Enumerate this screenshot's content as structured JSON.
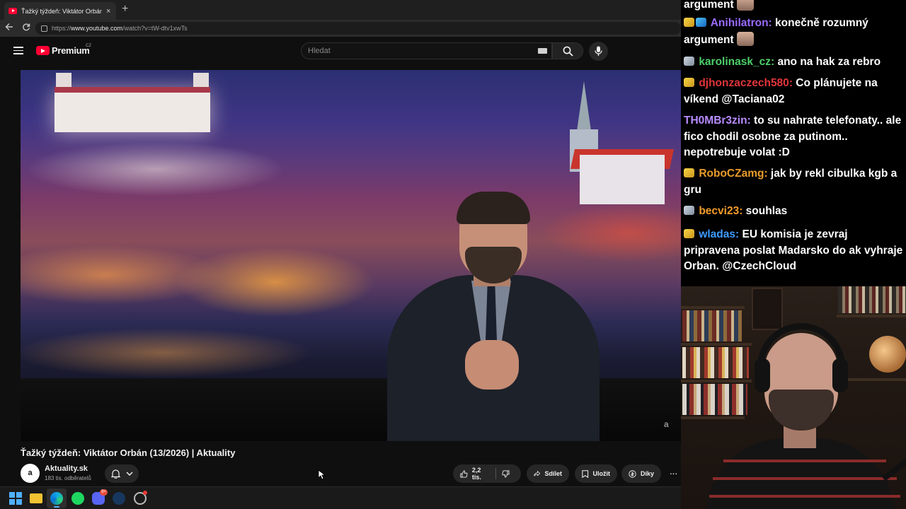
{
  "browser": {
    "tab_title": "Ťažký týždeň: Viktátor Orbán (13/2026) | Aktuality",
    "tab_close": "×",
    "new_tab": "+",
    "url_prefix": "https://",
    "url_host": "www.youtube.com",
    "url_path": "/watch?v=tW-dtv1xwTs"
  },
  "youtube": {
    "logo_text": "Premium",
    "country_code": "CZ",
    "search_placeholder": "Hledat"
  },
  "video": {
    "watermark": "a",
    "title": "Ťažký týždeň: Viktátor Orbán (13/2026) | Aktuality",
    "channel_avatar_letter": "a",
    "channel_name": "Aktuality.sk",
    "subscribers": "183 tis. odběratelů",
    "likes": "2,2 tis.",
    "share_label": "Sdílet",
    "save_label": "Uložit",
    "thanks_label": "Díky",
    "more_label": "···"
  },
  "taskbar": {
    "discord_badge": "9+"
  },
  "chat": {
    "messages": [
      {
        "badge": "",
        "user": "",
        "user_color": "#ffffff",
        "text": "argument"
      },
      {
        "badge": "gold",
        "user": "Anihilatron",
        "user_color": "#9b6bff",
        "text": "konečně rozumný argument"
      },
      {
        "badge": "silver",
        "user": "karolinask_cz",
        "user_color": "#4fd06a",
        "text": "ano na hak za rebro"
      },
      {
        "badge": "gold",
        "user": "djhonzaczech580",
        "user_color": "#e0353b",
        "text": "Co plánujete na víkend @Taciana02"
      },
      {
        "badge": "",
        "user": "TH0MBr3zin",
        "user_color": "#b88cff",
        "text": "to su nahrate telefonaty.. ale fico chodil osobne za putinom.. nepotrebuje volat :D"
      },
      {
        "badge": "gold",
        "user": "RoboCZamg",
        "user_color": "#e89b2a",
        "text": "jak by rekl cibulka kgb a gru"
      },
      {
        "badge": "silver",
        "user": "becvi23",
        "user_color": "#f39c2a",
        "text": "souhlas"
      },
      {
        "badge": "gold",
        "user": "wladas",
        "user_color": "#3f9bff",
        "text": "EU komisia je zevraj pripravena poslat Madarsko do ak vyhraje Orban. @CzechCloud"
      }
    ],
    "separator": ":"
  },
  "colors": {
    "yt_red": "#ff0033",
    "page_bg": "#0f0f0f",
    "pill_bg": "#272727"
  },
  "icons": [
    "hamburger-icon",
    "youtube-logo-icon",
    "keyboard-icon",
    "search-icon",
    "mic-icon",
    "bell-icon",
    "chevron-down-icon",
    "thumb-up-icon",
    "thumb-down-icon",
    "share-icon",
    "save-icon",
    "thanks-icon",
    "more-icon",
    "windows-icon",
    "folder-icon",
    "edge-icon",
    "spotify-icon",
    "discord-icon",
    "steam-icon"
  ]
}
